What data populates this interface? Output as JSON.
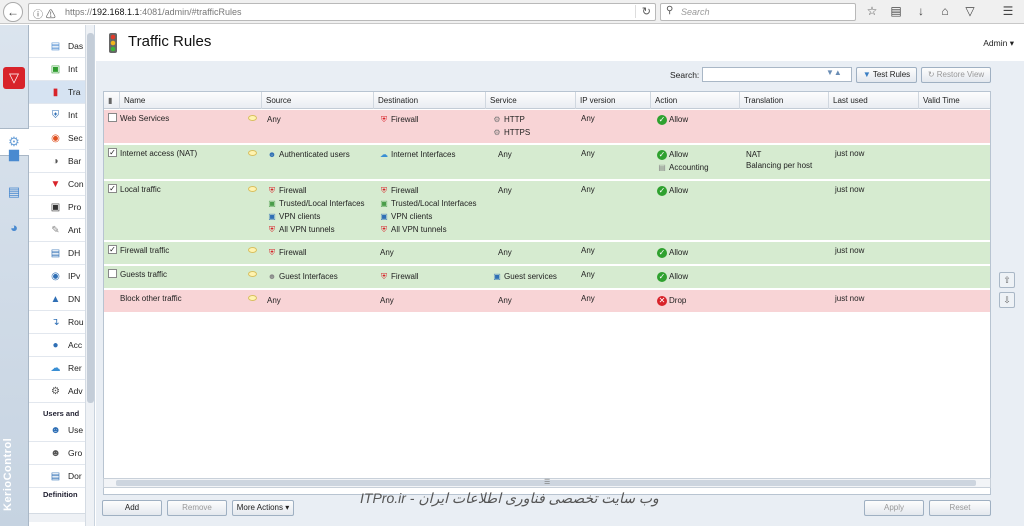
{
  "browser": {
    "url_prefix": "https://",
    "url_host": "192.168.1.1",
    "url_rest": ":4081/admin/#trafficRules",
    "search_placeholder": "Search"
  },
  "nav": {
    "items": [
      "Das",
      "Int",
      "Tra",
      "Int",
      "Sec",
      "Bar",
      "Con",
      "Pro",
      "Ant",
      "DH",
      "IPv",
      "DN",
      "Rou",
      "Acc",
      "Rer",
      "Adv"
    ],
    "section_users": "Users and",
    "users_items": [
      "Use",
      "Gro",
      "Dor"
    ],
    "section_definitions": "Definition"
  },
  "brand": "KerioControl",
  "page": {
    "title": "Traffic Rules",
    "admin": "Admin",
    "search_label": "Search:",
    "test_rules": "Test Rules",
    "restore_view": "Restore View"
  },
  "columns": [
    "Name",
    "Source",
    "Destination",
    "Service",
    "IP version",
    "Action",
    "Translation",
    "Last used",
    "Valid Time"
  ],
  "rules": [
    {
      "name": "Web Services",
      "checked": false,
      "source": [
        "Any"
      ],
      "destination": [
        "Firewall"
      ],
      "service": [
        "HTTP",
        "HTTPS"
      ],
      "ip": "Any",
      "action": [
        "Allow"
      ],
      "translation": [],
      "last_used": ""
    },
    {
      "name": "Internet access (NAT)",
      "checked": true,
      "source": [
        "Authenticated users"
      ],
      "destination": [
        "Internet Interfaces"
      ],
      "service": [
        "Any"
      ],
      "ip": "Any",
      "action": [
        "Allow",
        "Accounting"
      ],
      "translation": [
        "NAT",
        "Balancing per host"
      ],
      "last_used": "just now"
    },
    {
      "name": "Local traffic",
      "checked": true,
      "source": [
        "Firewall",
        "Trusted/Local Interfaces",
        "VPN clients",
        "All VPN tunnels"
      ],
      "destination": [
        "Firewall",
        "Trusted/Local Interfaces",
        "VPN clients",
        "All VPN tunnels"
      ],
      "service": [
        "Any"
      ],
      "ip": "Any",
      "action": [
        "Allow"
      ],
      "translation": [],
      "last_used": "just now"
    },
    {
      "name": "Firewall traffic",
      "checked": true,
      "source": [
        "Firewall"
      ],
      "destination": [
        "Any"
      ],
      "service": [
        "Any"
      ],
      "ip": "Any",
      "action": [
        "Allow"
      ],
      "translation": [],
      "last_used": "just now"
    },
    {
      "name": "Guests traffic",
      "checked": false,
      "source": [
        "Guest Interfaces"
      ],
      "destination": [
        "Firewall"
      ],
      "service": [
        "Guest services"
      ],
      "ip": "Any",
      "action": [
        "Allow"
      ],
      "translation": [],
      "last_used": ""
    },
    {
      "name": "Block other traffic",
      "checked": null,
      "source": [
        "Any"
      ],
      "destination": [
        "Any"
      ],
      "service": [
        "Any"
      ],
      "ip": "Any",
      "action": [
        "Drop"
      ],
      "translation": [],
      "last_used": "just now"
    }
  ],
  "footer": {
    "add": "Add",
    "remove": "Remove",
    "more_actions": "More Actions",
    "apply": "Apply",
    "reset": "Reset",
    "watermark": "وب سایت تخصصی فناوری اطلاعات ایران - ITPro.ir"
  }
}
